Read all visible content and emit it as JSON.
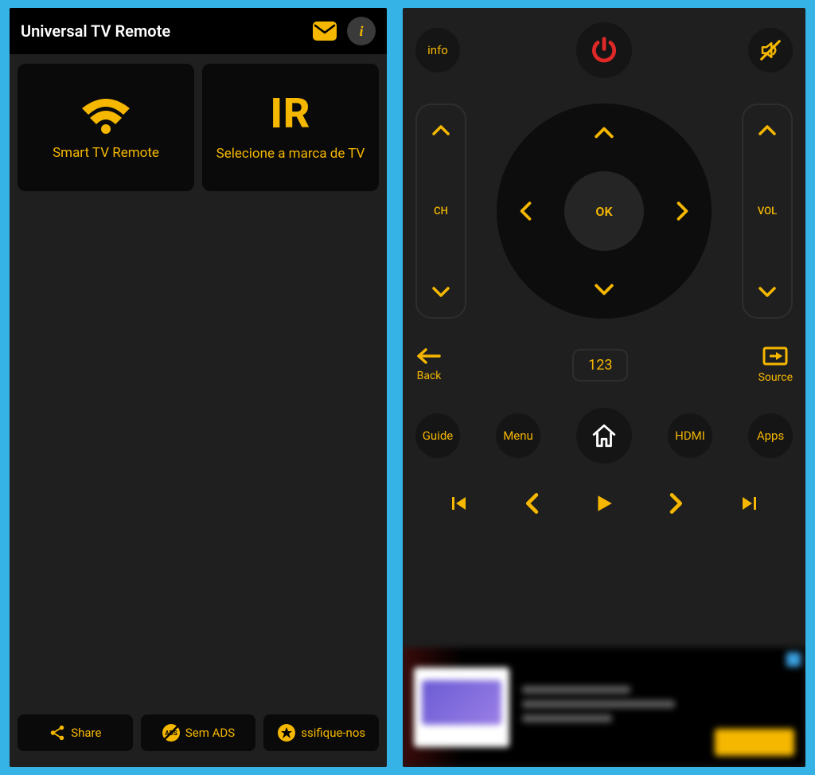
{
  "left": {
    "title": "Universal TV Remote",
    "info_glyph": "i",
    "card_smart": {
      "label": "Smart TV Remote"
    },
    "card_ir": {
      "big": "IR",
      "label": "Selecione a marca de TV"
    },
    "bottom": {
      "share": "Share",
      "noads": "Sem ADS",
      "noads_badge": "ADS",
      "rate": "ssifique-nos"
    }
  },
  "right": {
    "info": "info",
    "ch": "CH",
    "vol": "VOL",
    "ok": "OK",
    "back": "Back",
    "numpad": "123",
    "source": "Source",
    "guide": "Guide",
    "menu": "Menu",
    "hdmi": "HDMI",
    "apps": "Apps"
  }
}
